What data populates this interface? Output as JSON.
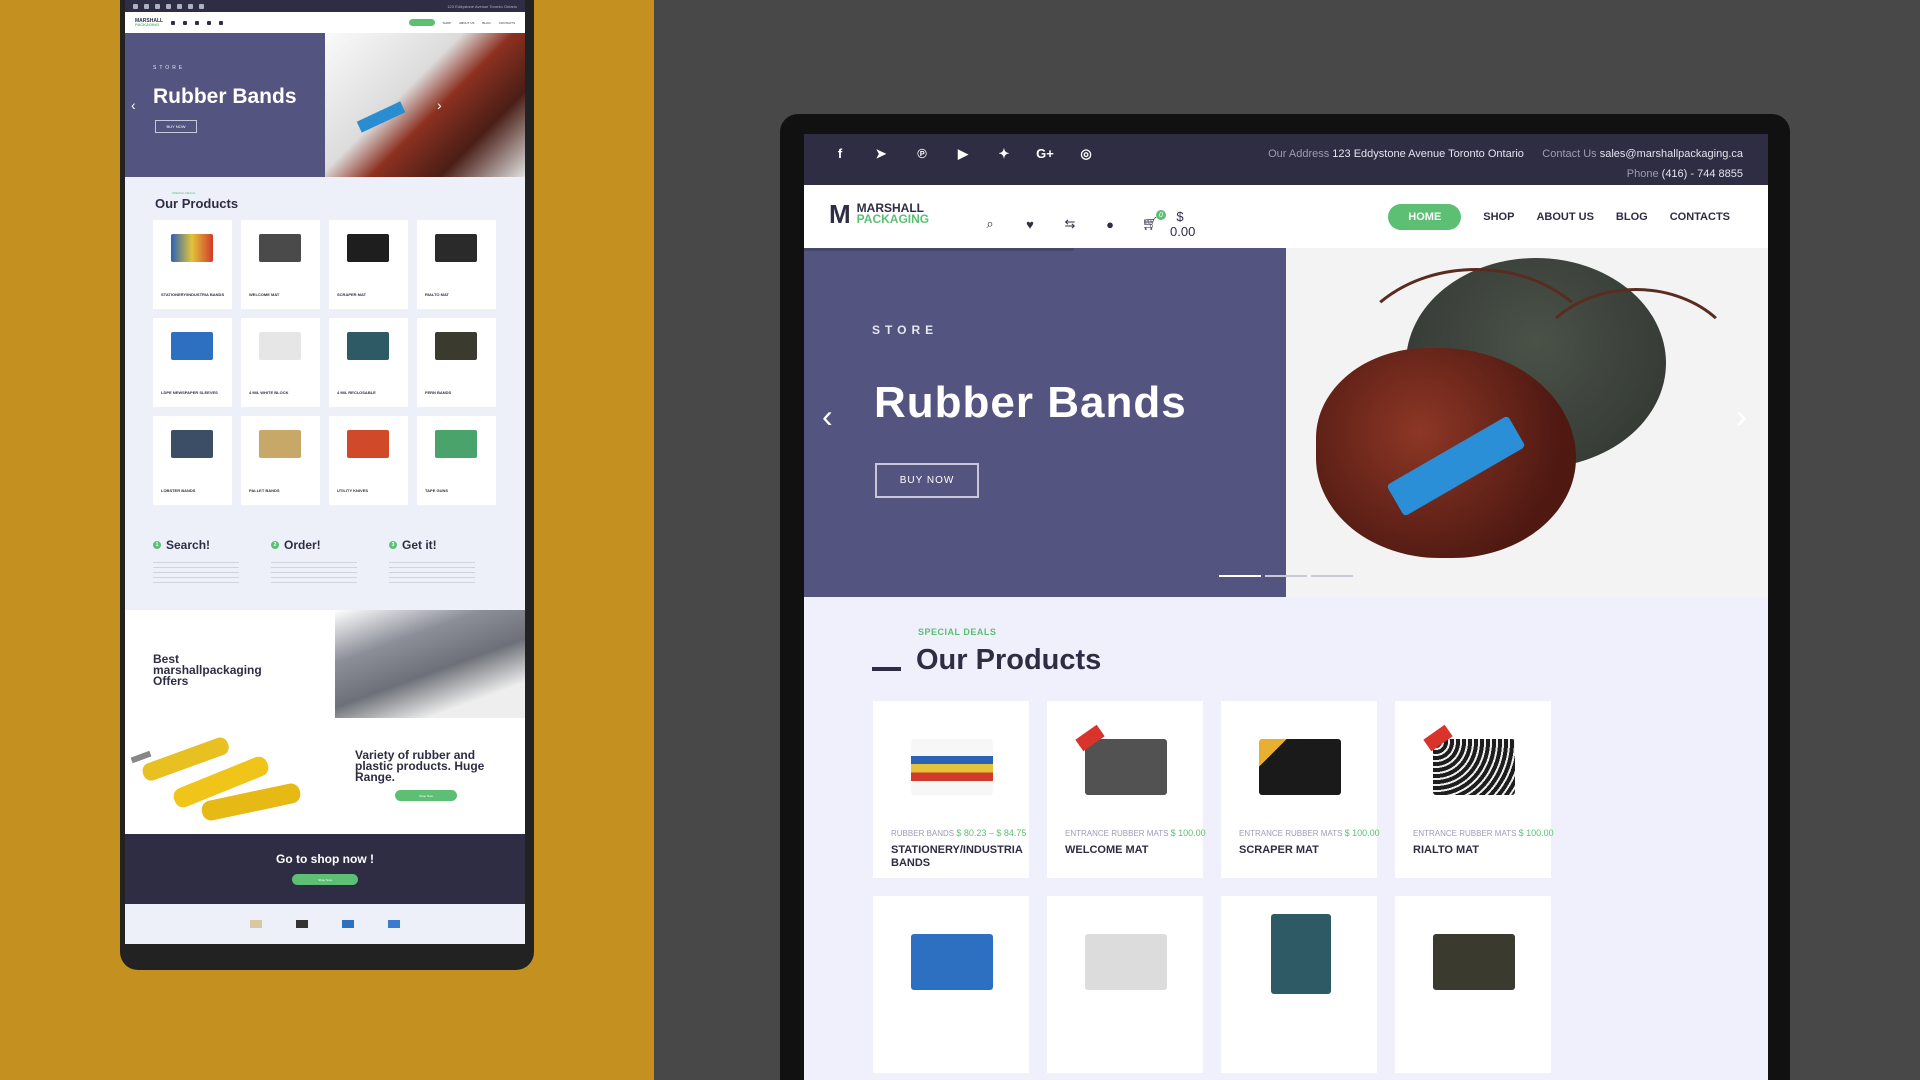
{
  "site": {
    "logo_line1": "MARSHALL",
    "logo_line2": "PACKAGING",
    "top_bar": {
      "address_label": "Our Address",
      "address": "123 Eddystone Avenue Toronto Ontario",
      "contact_label": "Contact Us",
      "email": "sales@marshallpackaging.ca",
      "phone_label": "Phone",
      "phone": "(416) - 744 8855"
    },
    "cart_total": "$ 0.00",
    "nav": [
      "HOME",
      "SHOP",
      "ABOUT US",
      "BLOG",
      "CONTACTS"
    ],
    "social_icons": [
      "facebook-icon",
      "telegram-icon",
      "pinterest-icon",
      "youtube-icon",
      "twitter-icon",
      "google-plus-icon",
      "instagram-icon"
    ],
    "toolbar_icons": [
      "search-icon",
      "heart-icon",
      "compare-icon",
      "user-icon",
      "cart-icon"
    ]
  },
  "hero": {
    "eyebrow": "STORE",
    "title": "Rubber Bands",
    "button": "BUY NOW"
  },
  "products_section": {
    "eyebrow": "SPECIAL DEALS",
    "title": "Our Products"
  },
  "products": [
    {
      "category": "RUBBER BANDS",
      "price": "$ 80.23 – $ 84.75",
      "name": "STATIONERY/INDUSTRIA BANDS"
    },
    {
      "category": "ENTRANCE RUBBER MATS",
      "price": "$ 100.00",
      "name": "WELCOME MAT"
    },
    {
      "category": "ENTRANCE RUBBER MATS",
      "price": "$ 100.00",
      "name": "SCRAPER MAT"
    },
    {
      "category": "ENTRANCE RUBBER MATS",
      "price": "$ 100.00",
      "name": "RIALTO MAT"
    }
  ],
  "phone_products": [
    "STATIONERY/INDUSTRIA BANDS",
    "WELCOME MAT",
    "SCRAPER MAT",
    "RIALTO MAT",
    "LDPE NEWSPAPER SLEEVES",
    "4 MIL WHITE BLOCK",
    "4 MIL RECLOSABLE",
    "FERN BANDS",
    "LOBSTER BANDS",
    "PALLET BANDS",
    "UTILITY KNIVES",
    "TAPE GUNS"
  ],
  "steps": [
    {
      "num": "1",
      "title": "Search!"
    },
    {
      "num": "2",
      "title": "Order!"
    },
    {
      "num": "3",
      "title": "Get it!"
    }
  ],
  "offers": {
    "title": "Best marshallpackaging Offers",
    "variety": "Variety of rubber and plastic products. Huge Range.",
    "shop_btn": "Shop Now"
  },
  "cta": {
    "title": "Go to shop now !",
    "button": "Shop Now"
  },
  "colors": {
    "accent": "#5cbf73",
    "navy": "#2e2d44",
    "hero_panel": "#545480",
    "left_bg": "#c4901f",
    "right_bg": "#484848"
  }
}
